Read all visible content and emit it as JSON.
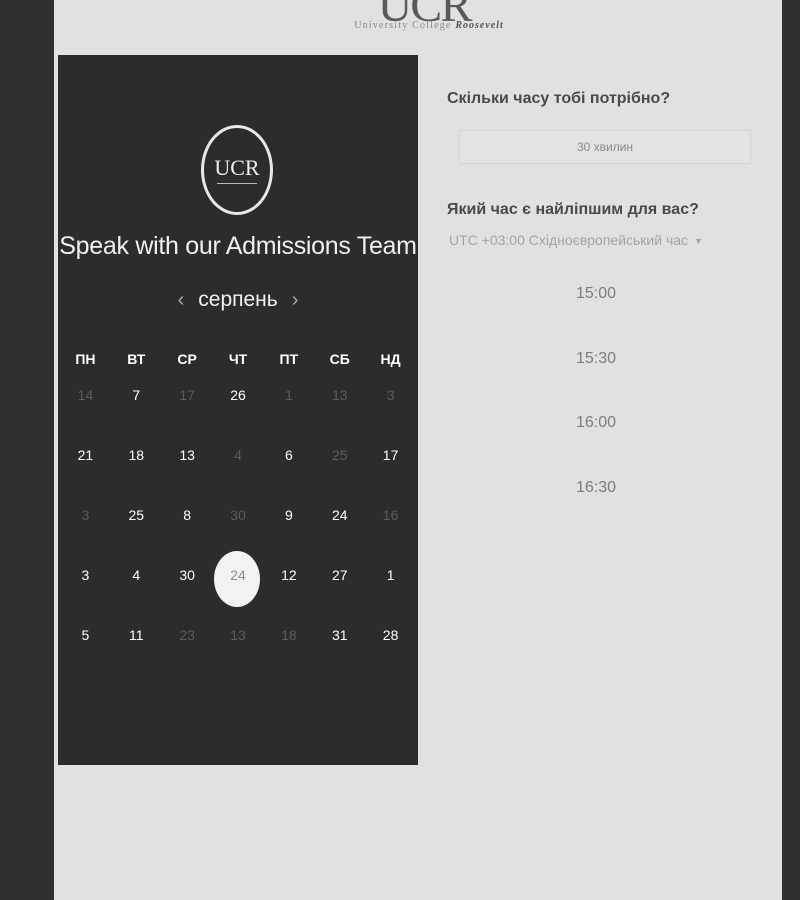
{
  "brand": {
    "top_logo_mark": "UCR",
    "top_logo_sub_a": "University College ",
    "top_logo_sub_b": "Roosevelt",
    "panel_logo_text": "UCR"
  },
  "panel": {
    "title": "Speak with our Admissions Team",
    "month": "серпень",
    "prev_icon": "‹",
    "next_icon": "›"
  },
  "calendar": {
    "weekdays": [
      "ПН",
      "ВТ",
      "СР",
      "ЧТ",
      "ПТ",
      "СБ",
      "НД"
    ],
    "rows": [
      [
        {
          "d": "14",
          "dim": true
        },
        {
          "d": "7"
        },
        {
          "d": "17",
          "dim": true
        },
        {
          "d": "26"
        },
        {
          "d": "1",
          "dim": true
        },
        {
          "d": "13",
          "dim": true
        },
        {
          "d": "3",
          "dim": true
        }
      ],
      [
        {
          "d": "21"
        },
        {
          "d": "18"
        },
        {
          "d": "13"
        },
        {
          "d": "4",
          "dim": true
        },
        {
          "d": "6"
        },
        {
          "d": "25",
          "dim": true
        },
        {
          "d": "17"
        }
      ],
      [
        {
          "d": "3",
          "dim": true
        },
        {
          "d": "25"
        },
        {
          "d": "8"
        },
        {
          "d": "30",
          "dim": true
        },
        {
          "d": "9"
        },
        {
          "d": "24"
        },
        {
          "d": "16",
          "dim": true
        }
      ],
      [
        {
          "d": "3"
        },
        {
          "d": "4"
        },
        {
          "d": "30"
        },
        {
          "d": "24",
          "sel": true
        },
        {
          "d": "12"
        },
        {
          "d": "27"
        },
        {
          "d": "1"
        }
      ],
      [
        {
          "d": "5"
        },
        {
          "d": "11"
        },
        {
          "d": "23",
          "dim": true
        },
        {
          "d": "13",
          "dim": true
        },
        {
          "d": "18",
          "dim": true
        },
        {
          "d": "31"
        },
        {
          "d": "28"
        }
      ]
    ]
  },
  "booking": {
    "duration_question": "Скільки часу тобі потрібно?",
    "duration_value": "30 хвилин",
    "time_question": "Який час є найліпшим для вас?",
    "timezone": "UTC +03:00 Східноєвропейський час",
    "timezone_caret": "▼",
    "slots": [
      "15:00",
      "15:30",
      "16:00",
      "16:30"
    ]
  },
  "colors": {
    "page_bg": "#2f2f2f",
    "sheet_bg": "#e1e1e1",
    "panel_bg": "#2c2c2c",
    "selected_day_bg": "#f2f2f2"
  }
}
